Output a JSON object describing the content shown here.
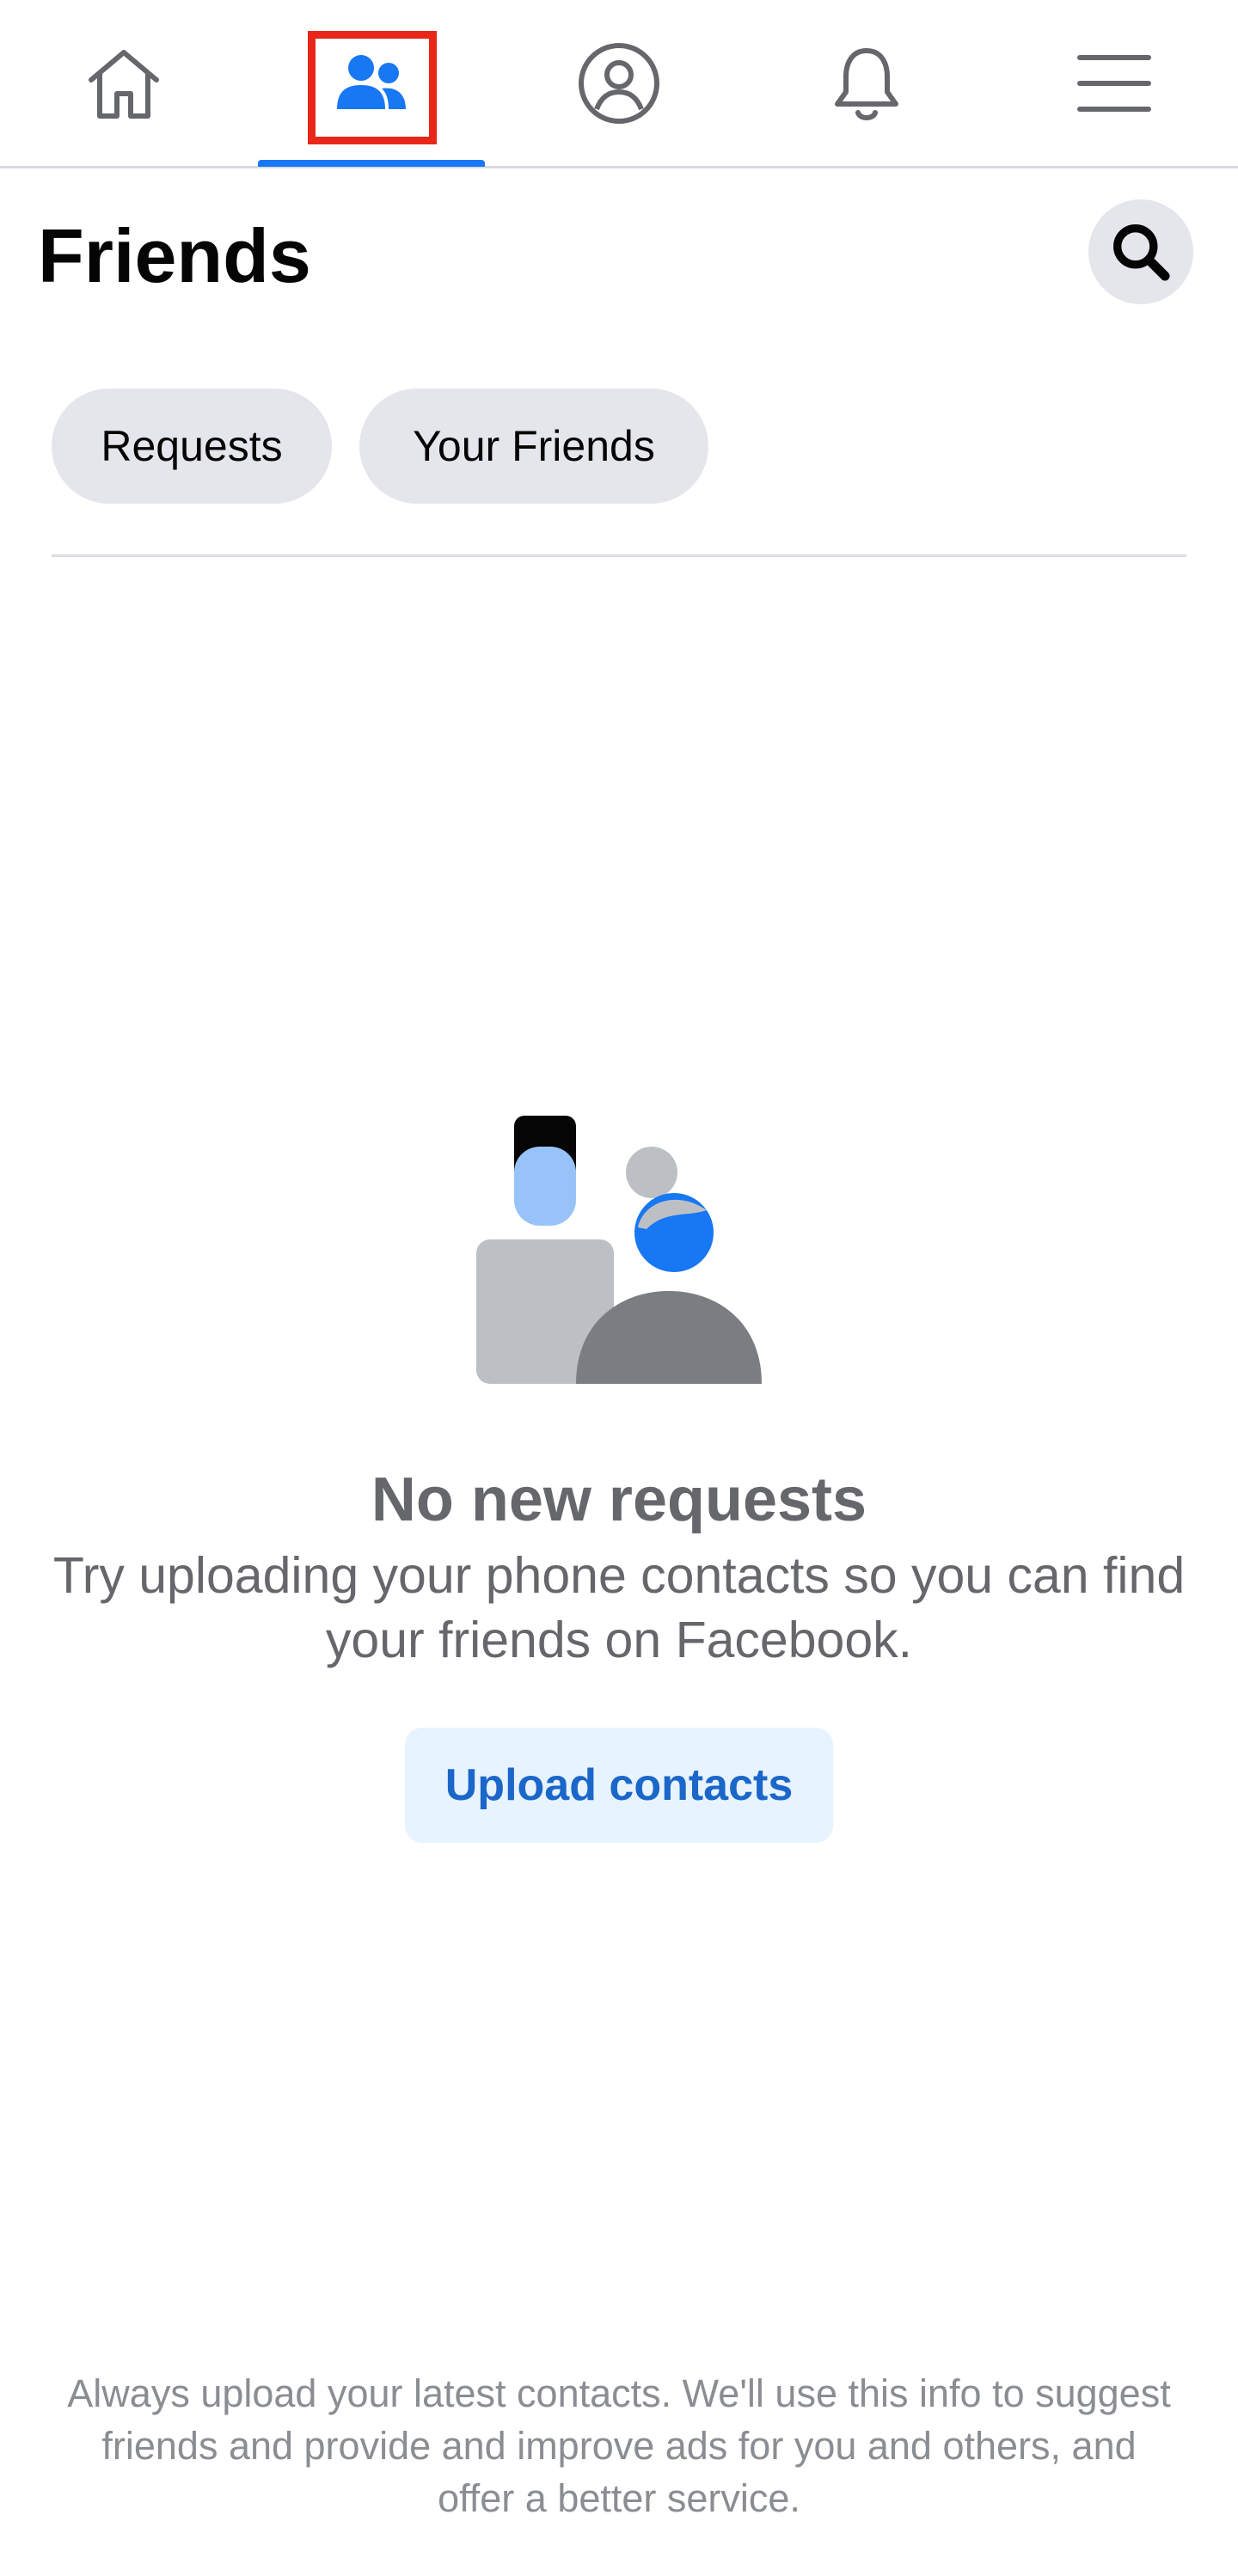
{
  "nav": {
    "tabs": [
      {
        "name": "home",
        "icon": "home-icon",
        "active": false
      },
      {
        "name": "friends",
        "icon": "friends-icon",
        "active": true
      },
      {
        "name": "profile",
        "icon": "profile-icon",
        "active": false
      },
      {
        "name": "notifications",
        "icon": "bell-icon",
        "active": false
      },
      {
        "name": "menu",
        "icon": "hamburger-menu-icon",
        "active": false
      }
    ]
  },
  "header": {
    "title": "Friends",
    "search_icon": "search-icon"
  },
  "chips": {
    "requests": "Requests",
    "your_friends": "Your Friends"
  },
  "empty_state": {
    "illustration": "friends-illustration",
    "title": "No new requests",
    "body": "Try uploading your phone contacts so you can find your friends on Facebook.",
    "button": "Upload contacts"
  },
  "footer": {
    "note": "Always upload your latest contacts. We'll use this info to suggest friends and provide and improve ads for you and others, and offer a better service."
  },
  "colors": {
    "accent": "#1877f2",
    "highlight": "#e8261a",
    "secondary_text": "#65676b",
    "chip_bg": "#e4e6eb",
    "button_bg": "#e7f3ff",
    "button_text": "#1b66c9"
  }
}
